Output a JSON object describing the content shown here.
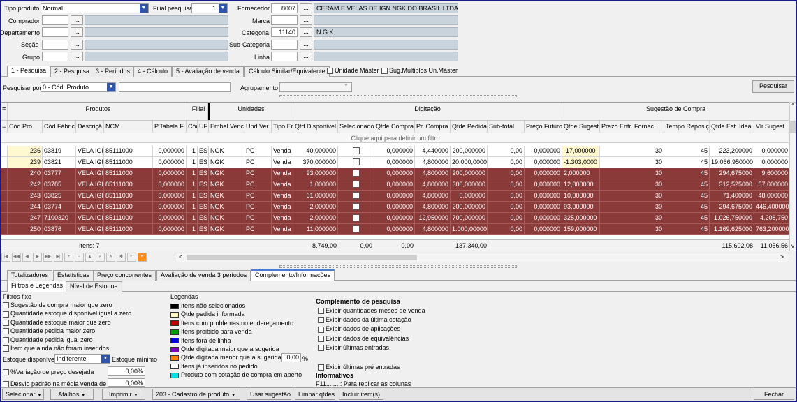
{
  "filters": {
    "tipo_produto_label": "Tipo produto",
    "tipo_produto_value": "Normal",
    "filial_label": "Filial pesquisa",
    "filial_value": "1",
    "comprador_label": "Comprador",
    "departamento_label": "Departamento",
    "secao_label": "Seção",
    "grupo_label": "Grupo",
    "fornecedor_label": "Fornecedor",
    "fornecedor_code": "8007",
    "fornecedor_name": "CERAM.E VELAS DE IGN.NGK DO BRASIL LTDA",
    "marca_label": "Marca",
    "categoria_label": "Categoria",
    "categoria_code": "11140",
    "categoria_name": "N.G.K.",
    "subcategoria_label": "Sub-Categoria",
    "linha_label": "Linha",
    "dots": "..."
  },
  "tabs": [
    "1 - Pesquisa",
    "2 - Pesquisa",
    "3 - Períodos",
    "4 - Cálculo",
    "5 - Avaliação de venda",
    "Cálculo Similar/Equivalente"
  ],
  "checks_top": [
    "Unidade Máster",
    "Sug.Multiplos Un.Máster"
  ],
  "search": {
    "label": "Pesquisar por",
    "value": "0 - Cód. Produto",
    "agrupamento_label": "Agrupamento",
    "button": "Pesquisar"
  },
  "grid": {
    "groups": [
      "Produtos",
      "Filial",
      "Unidades",
      "Digitação",
      "Sugestão de Compra"
    ],
    "columns": [
      "Cód.Pro",
      "Cód.Fábric",
      "Descriçã",
      "NCM",
      "P.Tabela F",
      "Cód",
      "UF",
      "Embal.Venc",
      "Und.Ver",
      "Tipo Er",
      "Qtd.Disponível",
      "Selecionado",
      "Qtde Compra",
      "Pr. Compra",
      "Qtde Pedida",
      "Sub-total",
      "Preço Futuro",
      "Qtde Sugest",
      "Prazo Entr. Fornec.",
      "Tempo Reposiç",
      "Qtde Est. Ideal",
      "Vlr.Sugest"
    ],
    "filter_hint": "Clique aqui para definir um filtro",
    "rows": [
      {
        "style": "w",
        "c": [
          "236",
          "03819",
          "VELA IGN",
          "85111000",
          "0,000000",
          "1",
          "ES",
          "NGK",
          "PC",
          "Venda",
          "40,000000",
          "",
          "0,000000",
          "4,440000",
          "200,000000",
          "0,00",
          "0,000000",
          "-17,000000",
          "30",
          "45",
          "223,200000",
          "0,000000"
        ]
      },
      {
        "style": "w",
        "c": [
          "239",
          "03821",
          "VELA IGN",
          "85111000",
          "0,000000",
          "1",
          "ES",
          "NGK",
          "PC",
          "Venda",
          "370,000000",
          "",
          "0,000000",
          "4,800000",
          "20.000,0000",
          "0,00",
          "0,000000",
          "-1.303,0000",
          "30",
          "45",
          "19.066,950000",
          "0,000000"
        ]
      },
      {
        "style": "r",
        "c": [
          "240",
          "03777",
          "VELA IGN",
          "85111000",
          "0,000000",
          "1",
          "ES",
          "NGK",
          "PC",
          "Venda",
          "93,000000",
          "",
          "0,000000",
          "4,800000",
          "200,000000",
          "0,00",
          "0,000000",
          "2,000000",
          "30",
          "45",
          "294,675000",
          "9,600000"
        ]
      },
      {
        "style": "r",
        "c": [
          "242",
          "03785",
          "VELA IGN",
          "85111000",
          "0,000000",
          "1",
          "ES",
          "NGK",
          "PC",
          "Venda",
          "1,000000",
          "",
          "0,000000",
          "4,800000",
          "300,000000",
          "0,00",
          "0,000000",
          "12,000000",
          "30",
          "45",
          "312,525000",
          "57,600000"
        ]
      },
      {
        "style": "r",
        "c": [
          "243",
          "03825",
          "VELA IGN",
          "85111000",
          "0,000000",
          "1",
          "ES",
          "NGK",
          "PC",
          "Venda",
          "61,000000",
          "",
          "0,000000",
          "4,800000",
          "0,000000",
          "0,00",
          "0,000000",
          "10,000000",
          "30",
          "45",
          "71,400000",
          "48,000000"
        ]
      },
      {
        "style": "r",
        "c": [
          "244",
          "03774",
          "VELA IGN",
          "85111000",
          "0,000000",
          "1",
          "ES",
          "NGK",
          "PC",
          "Venda",
          "2,000000",
          "",
          "0,000000",
          "4,800000",
          "200,000000",
          "0,00",
          "0,000000",
          "93,000000",
          "30",
          "45",
          "294,675000",
          "446,400000"
        ]
      },
      {
        "style": "r",
        "c": [
          "247",
          "7100320",
          "VELA IGN",
          "85111000",
          "0,000000",
          "1",
          "ES",
          "NGK",
          "PC",
          "Venda",
          "2,000000",
          "",
          "0,000000",
          "12,950000",
          "700,000000",
          "0,00",
          "0,000000",
          "325,000000",
          "30",
          "45",
          "1.026,750000",
          "4.208,750"
        ]
      },
      {
        "style": "r",
        "c": [
          "250",
          "03876",
          "VELA IGN",
          "85111000",
          "0,000000",
          "1",
          "ES",
          "NGK",
          "PC",
          "Venda",
          "11,000000",
          "",
          "0,000000",
          "4,800000",
          "1.000,00000",
          "0,00",
          "0,000000",
          "159,000000",
          "30",
          "45",
          "1.169,625000",
          "763,200000"
        ]
      }
    ],
    "footer": {
      "items": "Itens: 7",
      "qtd_disp": "8.749,00",
      "sel": "0,00",
      "qtde_compra": "0,00",
      "qtde_pedida": "137.340,00",
      "est_ideal": "115.602,08",
      "vlr_sug": "11.056,56"
    }
  },
  "lower_tabs": [
    "Totalizadores",
    "Estatísticas",
    "Preço concorrentes",
    "Avaliação de venda 3 períodos",
    "Complemento/Informações"
  ],
  "sub_tabs": [
    "Filtros e Legendas",
    "Nível de Estoque"
  ],
  "filtros": {
    "title": "Filtros fixo",
    "items": [
      "Sugestão de compra maior que zero",
      "Quantidade estoque disponível igual a zero",
      "Quantidade estoque maior que zero",
      "Quantidade pedida maior zero",
      "Quantidade pedida igual zero",
      "Item que ainda não foram inseridos"
    ],
    "estoque_label": "Estoque disponível",
    "estoque_value": "Indiferente",
    "estoque_min": "Estoque mínimo",
    "variacao_label": "%Variação de preço desejada",
    "variacao_value": "0,00%",
    "desvio_label": "Desvio padrão na média venda de",
    "desvio_value": "0,00%"
  },
  "legendas": {
    "title": "Legendas",
    "items": [
      {
        "text": "Itens não selecionados",
        "color": "#000000"
      },
      {
        "text": "Qtde pedida informada",
        "color": "#fff8c0"
      },
      {
        "text": "Itens com problemas no endereçamento",
        "color": "#c00000"
      },
      {
        "text": "Itens proibido para venda",
        "color": "#00a000"
      },
      {
        "text": "Itens fora de linha",
        "color": "#0000e0"
      },
      {
        "text": "Qtde digitada maior que a sugerida",
        "color": "#8000c0"
      },
      {
        "text": "Qtde digitada menor que a sugerida",
        "color": "#ff8000"
      },
      {
        "text": "Itens já inseridos no pedido",
        "color": "#ffffff"
      },
      {
        "text": "Produto com cotação de compra em aberto",
        "color": "#00e0e0"
      }
    ],
    "pct_value": "0,00",
    "pct": "%"
  },
  "complemento": {
    "title": "Complemento de pesquisa",
    "items": [
      "Exibir quantidades meses de venda",
      "Exibir dados da última cotação",
      "Exibir dados de aplicações",
      "Exibir dados de equivalências",
      "Exibir últimas entradas"
    ],
    "extra": "Exibir últimas pré entradas",
    "info_title": "Informativos",
    "info_line": "F11........: Para replicar as colunas"
  },
  "bottom": {
    "selecionar": "Selecionar",
    "atalhos": "Atalhos",
    "imprimir": "Imprimir",
    "cadastro": "203 - Cadastro de produto",
    "usar": "Usar sugestão",
    "limpar": "Limpar qtdes",
    "incluir": "Incluir item(s)",
    "fechar": "Fechar"
  }
}
